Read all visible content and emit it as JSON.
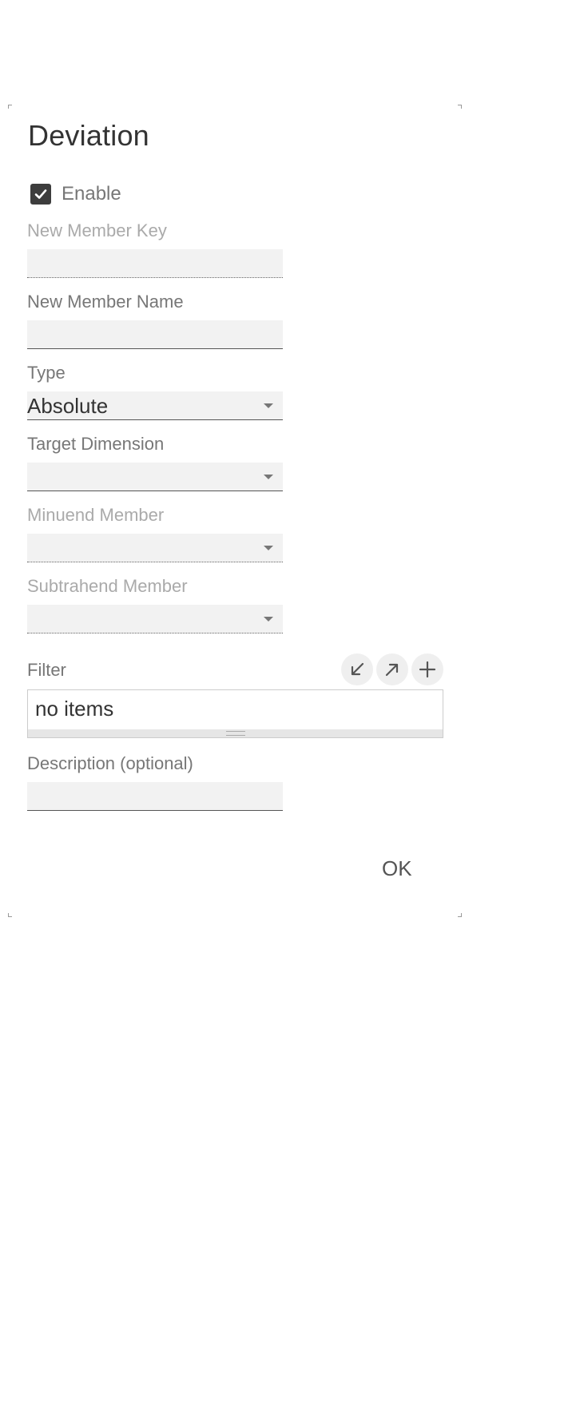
{
  "dialog": {
    "title": "Deviation",
    "enable": {
      "label": "Enable",
      "checked": true
    },
    "fields": {
      "new_member_key": {
        "label": "New Member Key",
        "value": ""
      },
      "new_member_name": {
        "label": "New Member Name",
        "value": ""
      },
      "type": {
        "label": "Type",
        "value": "Absolute"
      },
      "target_dimension": {
        "label": "Target Dimension",
        "value": ""
      },
      "minuend_member": {
        "label": "Minuend Member",
        "value": ""
      },
      "subtrahend_member": {
        "label": "Subtrahend Member",
        "value": ""
      },
      "filter": {
        "label": "Filter",
        "empty_text": "no items"
      },
      "description": {
        "label": "Description (optional)",
        "value": ""
      }
    },
    "buttons": {
      "ok": "OK"
    },
    "icons": {
      "collapse": "arrow-down-left-icon",
      "expand": "arrow-up-right-icon",
      "add": "plus-icon",
      "check": "checkmark-icon",
      "caret": "caret-down-icon",
      "grip": "resize-grip-icon"
    },
    "colors": {
      "checkbox_fill": "#3d3d3d",
      "input_bg": "#f2f2f2",
      "disabled_label": "#aaaaaa"
    }
  }
}
